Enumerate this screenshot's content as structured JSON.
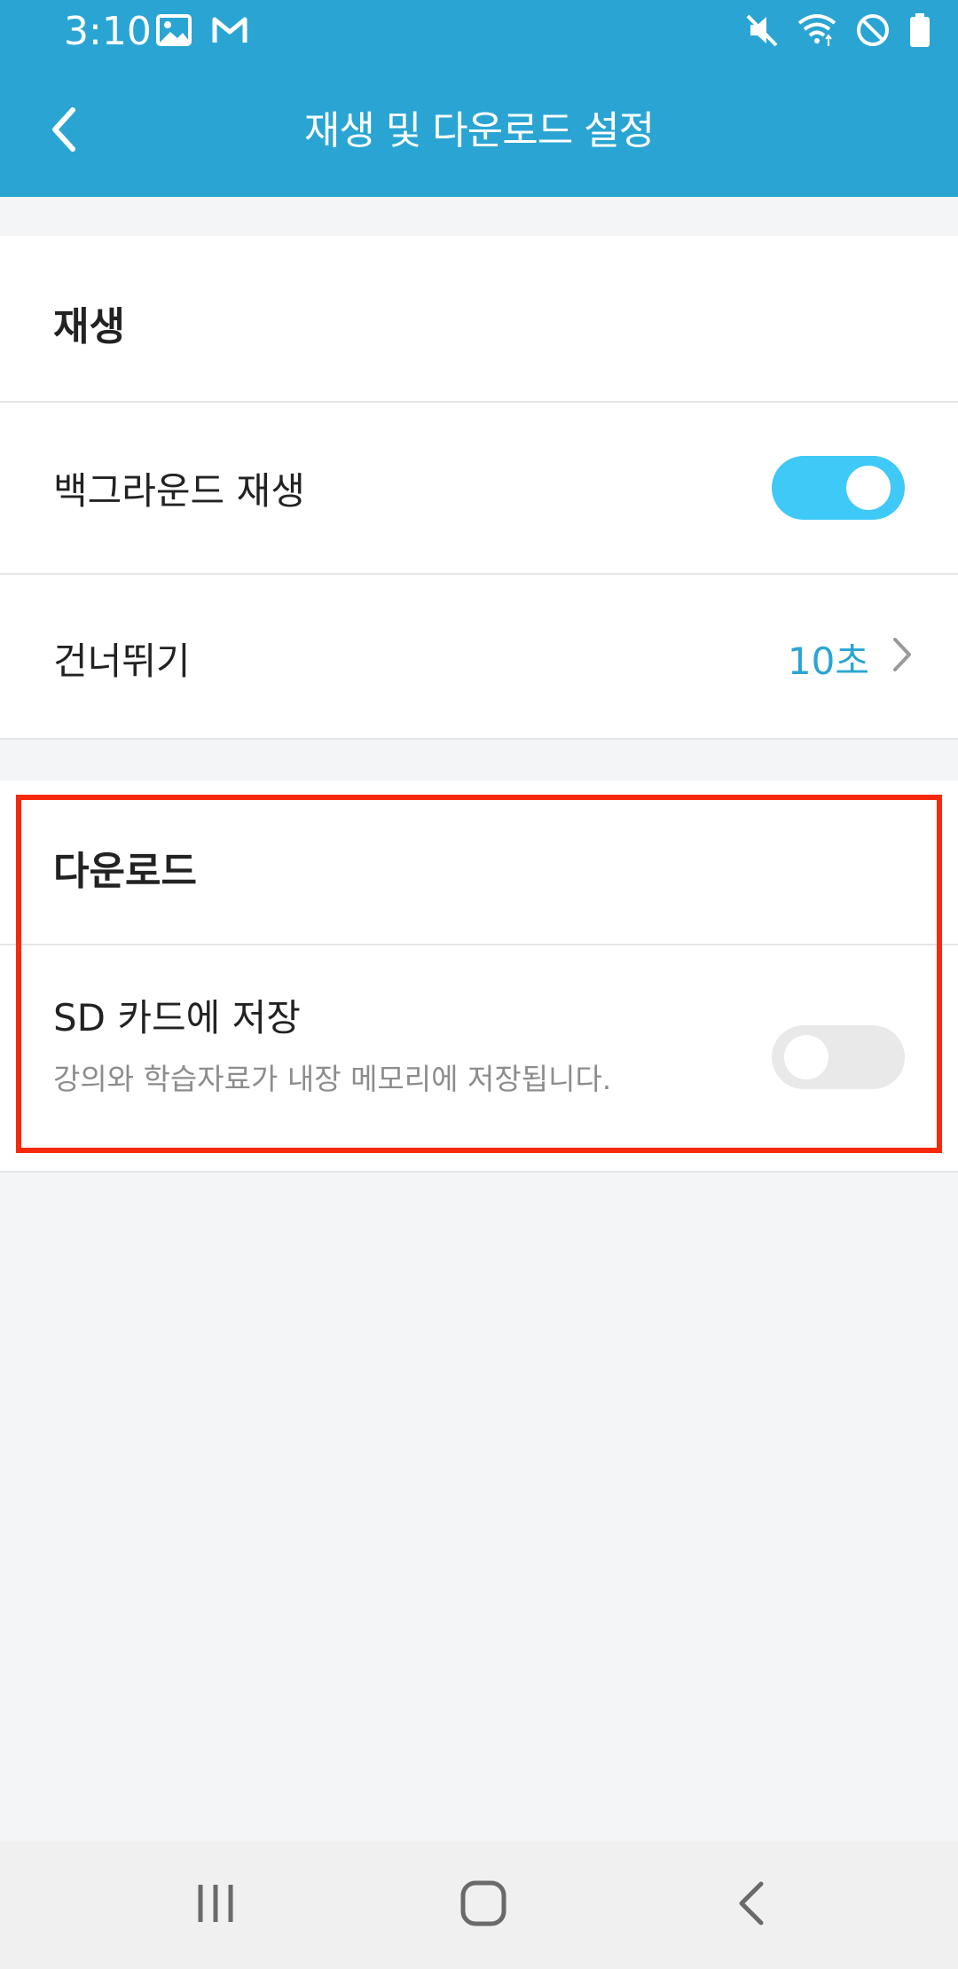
{
  "status_bar": {
    "time": "3:10",
    "left_icons": [
      "image-icon",
      "gmail-icon"
    ],
    "right_icons": [
      "mute-icon",
      "wifi-icon",
      "do-not-disturb-icon",
      "battery-icon"
    ]
  },
  "app_bar": {
    "title": "재생 및 다운로드 설정",
    "back_icon": "chevron-left-icon"
  },
  "playback": {
    "header": "재생",
    "background_play": {
      "label": "백그라운드 재생",
      "enabled": true
    },
    "skip": {
      "label": "건너뛰기",
      "value": "10초"
    }
  },
  "download": {
    "header": "다운로드",
    "sd_card": {
      "label": "SD 카드에 저장",
      "description": "강의와 학습자료가 내장 메모리에 저장됩니다.",
      "enabled": false
    }
  },
  "nav_bar": {
    "buttons": [
      "recent-apps-icon",
      "home-icon",
      "back-icon"
    ]
  },
  "colors": {
    "primary": "#2aa5d3",
    "toggle_on": "#3ec9f6",
    "highlight": "#f52a0d"
  }
}
